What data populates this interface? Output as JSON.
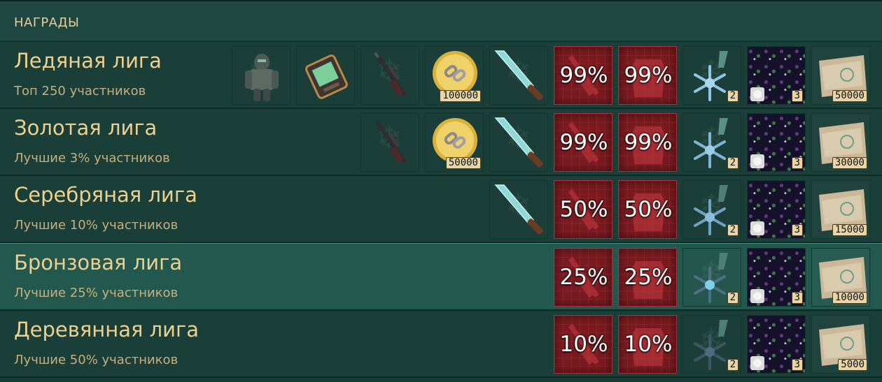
{
  "header": {
    "title": "НАГРАДЫ"
  },
  "leagues": [
    {
      "name": "Ледяная лига",
      "subtitle": "Топ 250 участников",
      "coins": "100000",
      "boosts": [
        "99%",
        "99%"
      ],
      "snowflake_count": "2",
      "wallpaper_count": "3",
      "map_count": "50000"
    },
    {
      "name": "Золотая лига",
      "subtitle": "Лучшие 3% участников",
      "coins": "50000",
      "boosts": [
        "99%",
        "99%"
      ],
      "snowflake_count": "2",
      "wallpaper_count": "3",
      "map_count": "30000"
    },
    {
      "name": "Серебряная лига",
      "subtitle": "Лучшие 10% участников",
      "boosts": [
        "50%",
        "50%"
      ],
      "snowflake_count": "2",
      "wallpaper_count": "3",
      "map_count": "15000"
    },
    {
      "name": "Бронзовая лига",
      "subtitle": "Лучшие 25% участников",
      "boosts": [
        "25%",
        "25%"
      ],
      "snowflake_count": "2",
      "wallpaper_count": "3",
      "map_count": "10000"
    },
    {
      "name": "Деревянная лига",
      "subtitle": "Лучшие 50% участников",
      "boosts": [
        "10%",
        "10%"
      ],
      "snowflake_count": "2",
      "wallpaper_count": "3",
      "map_count": "5000"
    }
  ],
  "icons": {
    "armor": "armor-suit-icon",
    "device": "tablet-device-icon",
    "rifle": "sniper-rifle-icon",
    "coin": "gold-coin-chain-icon",
    "knife": "ice-knife-icon",
    "weapon_boost": "weapon-boost-icon",
    "armor_boost": "armor-boost-icon",
    "snowflake": "snowflake-medal-icon",
    "wallpaper": "wallpaper-icon",
    "map": "map-icon"
  },
  "colors": {
    "background": "#183b35",
    "text_gold": "#ecd08f",
    "boost_red": "#7a1a20",
    "highlight_row": "#23584e"
  }
}
